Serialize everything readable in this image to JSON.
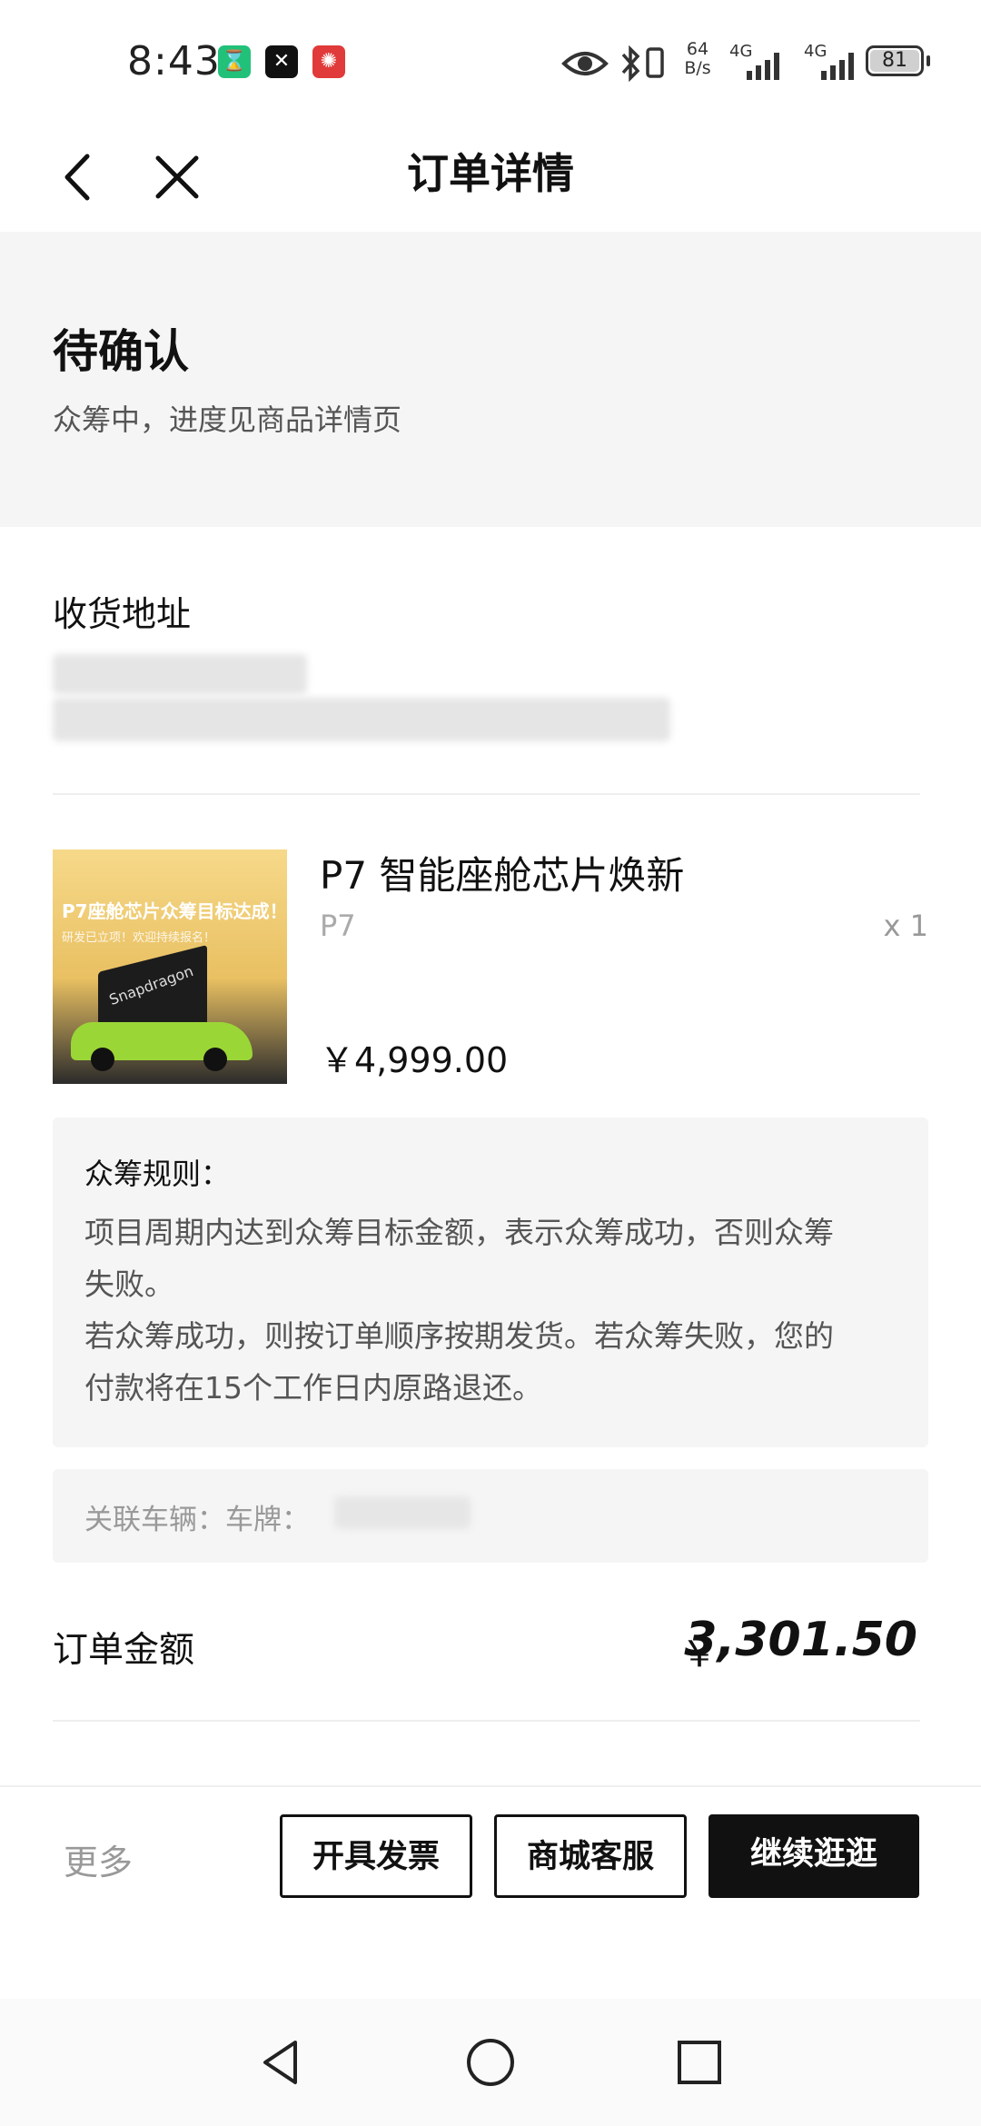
{
  "status_bar": {
    "time": "8:43",
    "net_speed_top": "64",
    "net_speed_bottom": "B/s",
    "signal_1": "4G",
    "signal_2": "4G",
    "battery": "81",
    "icons": [
      "hourglass-icon",
      "capcut-icon",
      "red-app-icon",
      "eye-icon",
      "bluetooth-icon",
      "vibrate-icon",
      "signal-icon",
      "battery-icon"
    ]
  },
  "nav": {
    "title": "订单详情"
  },
  "order_status": {
    "title": "待确认",
    "subtitle": "众筹中，进度见商品详情页"
  },
  "address": {
    "title": "收货地址"
  },
  "product": {
    "name": "P7 智能座舱芯片焕新",
    "spec": "P7",
    "qty": "x 1",
    "price": "￥4,999.00",
    "thumb_text_1": "P7座舱芯片众筹目标达成！",
    "thumb_text_2": "研发已立项！欢迎持续报名！",
    "thumb_brand": "Snapdragon"
  },
  "rules": {
    "title": "众筹规则：",
    "lines": [
      "项目周期内达到众筹目标金额，表示众筹成功，否则众筹",
      "失败。",
      "若众筹成功，则按订单顺序按期发货。若众筹失败，您的",
      "付款将在15个工作日内原路退还。"
    ]
  },
  "vehicle": {
    "label": "关联车辆：车牌："
  },
  "amount": {
    "label": "订单金额",
    "currency": "￥",
    "value": "3,301.50"
  },
  "bottom_bar": {
    "more": "更多",
    "invoice": "开具发票",
    "service": "商城客服",
    "continue": "继续逛逛"
  },
  "colors": {
    "accent": "#111111",
    "panel_bg": "#f5f5f5",
    "product_green": "#9bd637"
  }
}
